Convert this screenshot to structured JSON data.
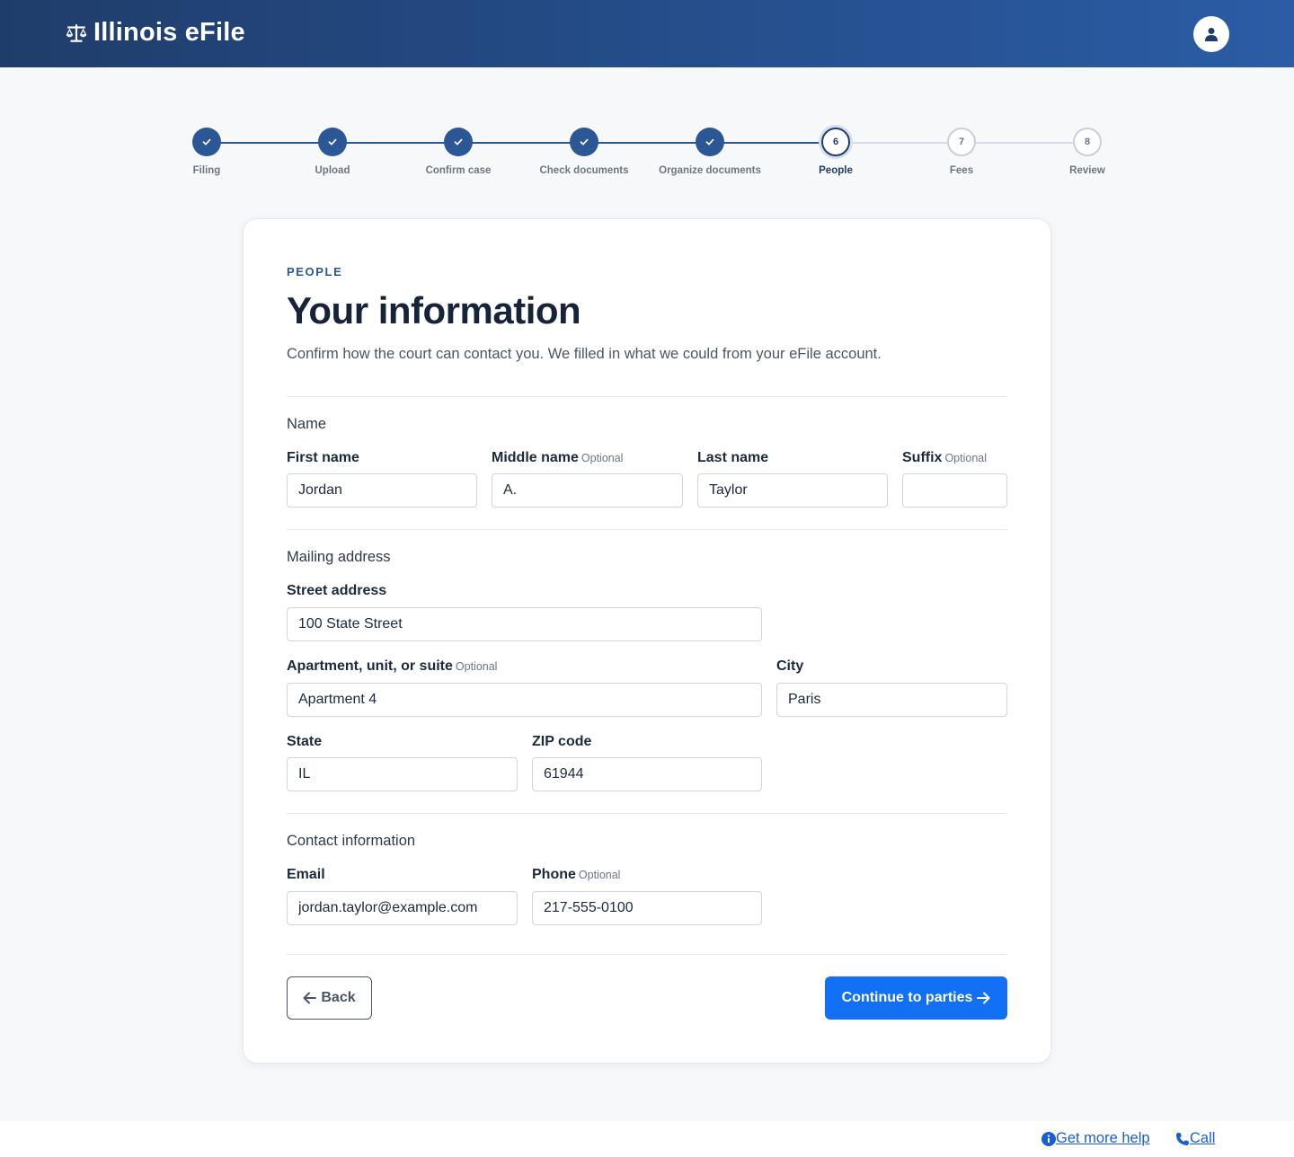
{
  "header": {
    "title": "Illinois eFile",
    "logo_icon": "scales-icon",
    "account_icon": "user-icon",
    "colors": {
      "start": "#1f3d6b",
      "end": "#2b5ca5"
    }
  },
  "stepper": {
    "steps": [
      {
        "label": "Filing",
        "number": "1",
        "state": "done"
      },
      {
        "label": "Upload",
        "number": "2",
        "state": "done"
      },
      {
        "label": "Confirm case",
        "number": "3",
        "state": "done"
      },
      {
        "label": "Check documents",
        "number": "4",
        "state": "done"
      },
      {
        "label": "Organize documents",
        "number": "5",
        "state": "done"
      },
      {
        "label": "People",
        "number": "6",
        "state": "current"
      },
      {
        "label": "Fees",
        "number": "7",
        "state": "future"
      },
      {
        "label": "Review",
        "number": "8",
        "state": "future"
      }
    ]
  },
  "card": {
    "eyebrow": "PEOPLE",
    "title": "Your information",
    "description": "Confirm how the court can contact you. We filled in what we could from your eFile account."
  },
  "sections": {
    "name": {
      "title": "Name",
      "first_name": {
        "label": "First name",
        "value": "Jordan"
      },
      "middle_name": {
        "label": "Middle name",
        "optional": "Optional",
        "value": "A."
      },
      "last_name": {
        "label": "Last name",
        "value": "Taylor"
      },
      "suffix": {
        "label": "Suffix",
        "optional": "Optional",
        "value": ""
      }
    },
    "address": {
      "title": "Mailing address",
      "street": {
        "label": "Street address",
        "value": "100 State Street"
      },
      "apartment": {
        "label": "Apartment, unit, or suite",
        "optional": "Optional",
        "value": "Apartment 4"
      },
      "city": {
        "label": "City",
        "value": "Paris"
      },
      "state": {
        "label": "State",
        "value": "IL"
      },
      "zip": {
        "label": "ZIP code",
        "value": "61944"
      }
    },
    "contact": {
      "title": "Contact information",
      "email": {
        "label": "Email",
        "value": "jordan.taylor@example.com"
      },
      "phone": {
        "label": "Phone",
        "optional": "Optional",
        "value": "217-555-0100"
      }
    }
  },
  "actions": {
    "back_label": "Back",
    "continue_label": "Continue to parties",
    "continue_color": "#1170f4"
  },
  "footer": {
    "help_label": "Get more help",
    "help_icon": "info-icon",
    "call_label": "Call",
    "call_icon": "phone-icon"
  }
}
